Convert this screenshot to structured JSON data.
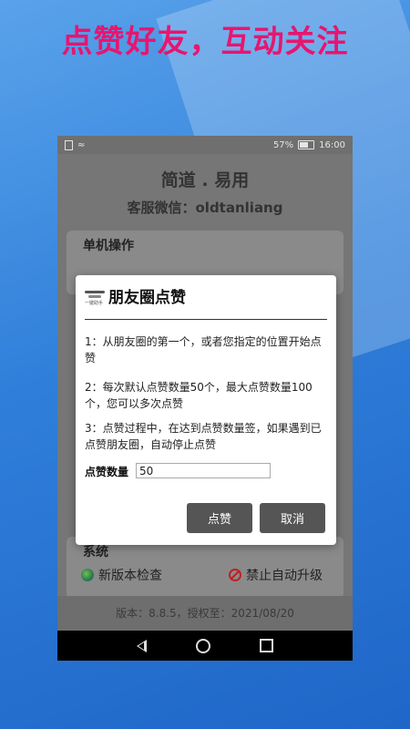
{
  "promo": {
    "title": "点赞好友，互动关注"
  },
  "status_bar": {
    "battery": "57%",
    "time": "16:00"
  },
  "app": {
    "title": "简道 . 易用",
    "subtitle": "客服微信：oldtanliang",
    "section_single": "单机操作",
    "section_system": "系统",
    "system_items": [
      {
        "label": "新版本检查",
        "icon": "globe-icon"
      },
      {
        "label": "禁止自动升级",
        "icon": "no-entry-icon"
      }
    ],
    "version_text": "版本：8.8.5，授权至：2021/08/20"
  },
  "dialog": {
    "title": "朋友圈点赞",
    "paragraphs": [
      "1：从朋友圈的第一个，或者您指定的位置开始点赞",
      "2：每次默认点赞数量50个，最大点赞数量100个，您可以多次点赞",
      "3：点赞过程中，在达到点赞数量签，如果遇到已点赞朋友圈，自动停止点赞"
    ],
    "quantity_label": "点赞数量",
    "quantity_value": "50",
    "confirm_label": "点赞",
    "cancel_label": "取消",
    "logo_text": "一键助手"
  },
  "colors": {
    "promo_title": "#e8156f",
    "button": "#555555"
  }
}
